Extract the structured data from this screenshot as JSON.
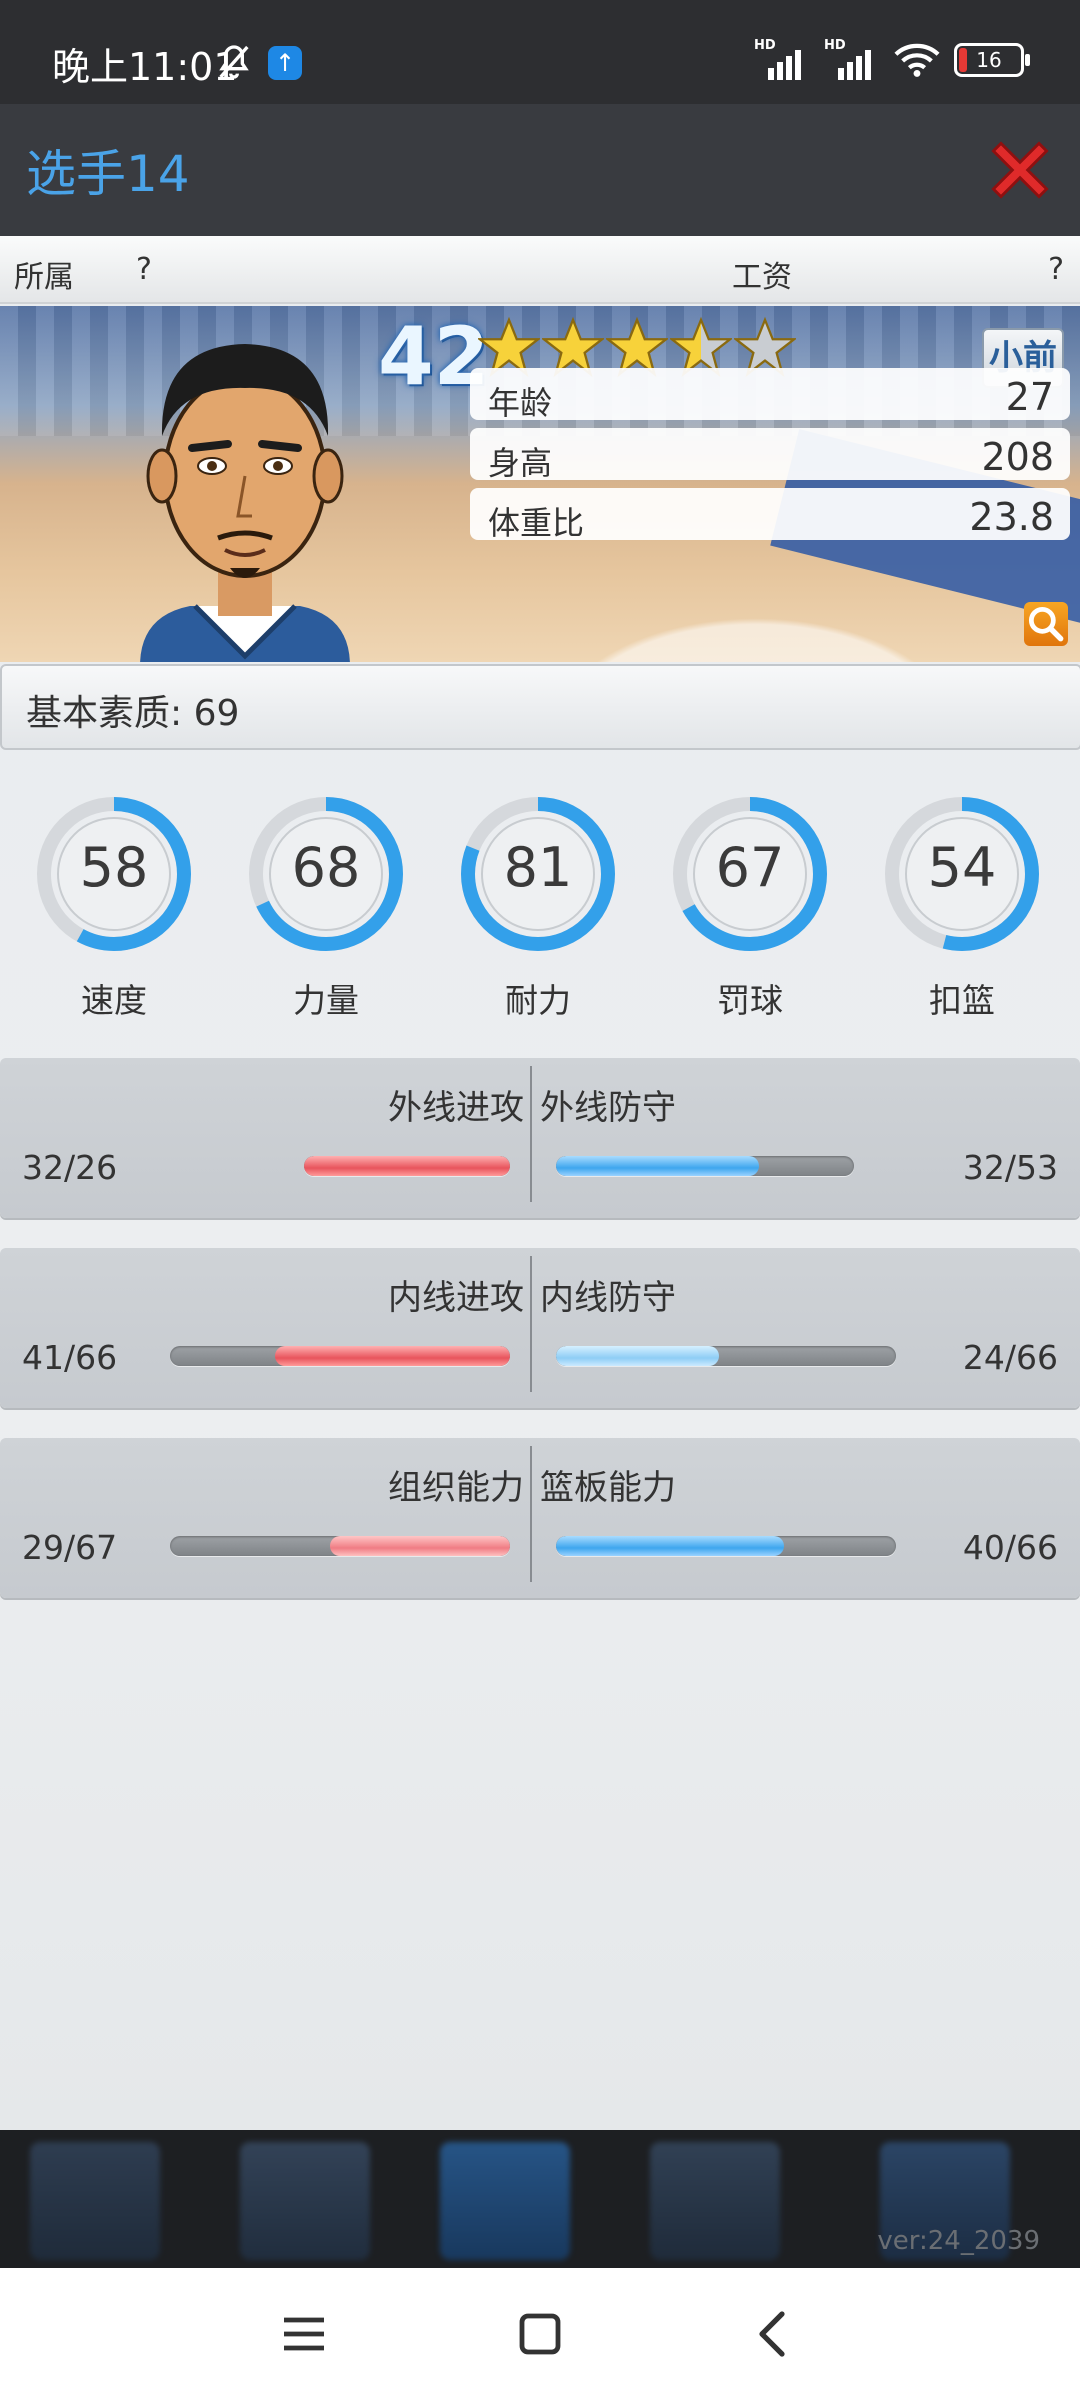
{
  "status_bar": {
    "time": "晚上11:01",
    "battery": "16",
    "icons": [
      "bell-off-icon",
      "upload-icon",
      "hd-signal-icon",
      "hd-signal-icon",
      "wifi-icon",
      "battery-icon"
    ]
  },
  "header": {
    "title": "选手14",
    "close_icon": "close-icon"
  },
  "info_row": {
    "team_label": "所属",
    "team_value": "?",
    "salary_label": "工资",
    "salary_value": "?"
  },
  "player": {
    "rating": "42",
    "stars": 3.5,
    "stars_max": 5,
    "position": "小前",
    "attributes": [
      {
        "label": "年龄",
        "value": "27"
      },
      {
        "label": "身高",
        "value": "208"
      },
      {
        "label": "体重比",
        "value": "23.8"
      }
    ]
  },
  "basic_quality": "基本素质: 69",
  "gauges": [
    {
      "label": "速度",
      "value": "58",
      "percent": 58
    },
    {
      "label": "力量",
      "value": "68",
      "percent": 68
    },
    {
      "label": "耐力",
      "value": "81",
      "percent": 81
    },
    {
      "label": "罚球",
      "value": "67",
      "percent": 67
    },
    {
      "label": "扣篮",
      "value": "54",
      "percent": 54
    }
  ],
  "skill_rows": [
    {
      "left": {
        "label": "外线进攻",
        "value": "32/26",
        "color": "#e8545c",
        "fraction": 1.0
      },
      "right": {
        "label": "外线防守",
        "value": "32/53",
        "color": "#3ea6ee",
        "fraction": 0.68
      }
    },
    {
      "left": {
        "label": "内线进攻",
        "value": "41/66",
        "color": "#e8545c",
        "fraction": 0.69
      },
      "right": {
        "label": "内线防守",
        "value": "24/66",
        "color": "#8ecdf5",
        "fraction": 0.48
      }
    },
    {
      "left": {
        "label": "组织能力",
        "value": "29/67",
        "color": "#f07c84",
        "fraction": 0.53
      },
      "right": {
        "label": "篮板能力",
        "value": "40/66",
        "color": "#3ea6ee",
        "fraction": 0.67
      }
    }
  ],
  "footer": {
    "version": "ver:24_2039"
  }
}
